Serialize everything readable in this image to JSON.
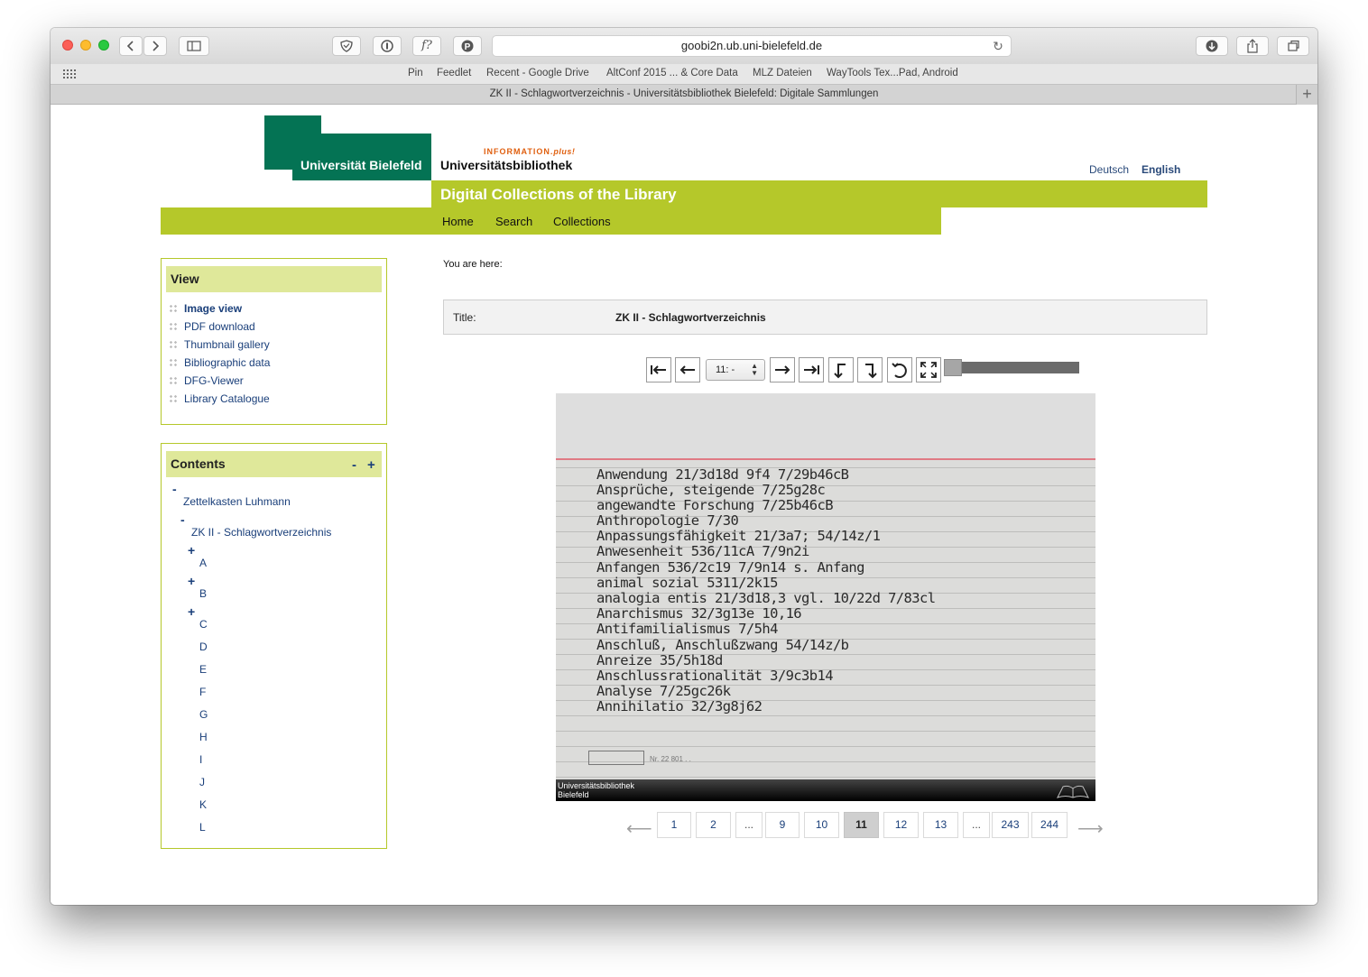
{
  "browser": {
    "url": "goobi2n.ub.uni-bielefeld.de",
    "bookmarks": [
      "Pin",
      "Feedlet",
      "Recent - Google Drive",
      "AltConf 2015 ... & Core Data",
      "MLZ Dateien",
      "WayTools Tex...Pad, Android"
    ],
    "tab_title": "ZK II - Schlagwortverzeichnis - Universitätsbibliothek Bielefeld: Digitale Sammlungen"
  },
  "header": {
    "university": "Universität Bielefeld",
    "info_prefix": "INFORMATION.",
    "info_plus": "plus!",
    "library": "Universitätsbibliothek",
    "lang_de": "Deutsch",
    "lang_en": "English",
    "banner": "Digital Collections of the Library",
    "nav": [
      "Home",
      "Search",
      "Collections"
    ]
  },
  "view_box": {
    "title": "View",
    "items": [
      "Image view",
      "PDF download",
      "Thumbnail gallery",
      "Bibliographic data",
      "DFG-Viewer",
      "Library Catalogue"
    ]
  },
  "contents_box": {
    "title": "Contents",
    "collapse_all": "-",
    "expand_all": "+",
    "root": "Zettelkasten Luhmann",
    "child": "ZK II - Schlagwortverzeichnis",
    "letters": [
      "A",
      "B",
      "C",
      "D",
      "E",
      "F",
      "G",
      "H",
      "I",
      "J",
      "K",
      "L"
    ],
    "expandable_letters": [
      "A",
      "B",
      "C"
    ]
  },
  "main": {
    "breadcrumb": "You are here:",
    "title_label": "Title:",
    "title_value": "ZK II - Schlagwortverzeichnis",
    "page_select": "11: -",
    "zoom_level": 0
  },
  "scan": {
    "lines": [
      "Anwendung 21/3d18d 9f4 7/29b46cB",
      "Ansprüche, steigende 7/25g28c",
      "angewandte Forschung 7/25b46cB",
      "Anthropologie 7/30",
      "Anpassungsfähigkeit 21/3a7; 54/14z/1",
      "Anwesenheit 536/11cA 7/9n2i",
      "Anfangen 536/2c19 7/9n14 s. Anfang",
      "animal sozial 5311/2k15",
      "analogia entis 21/3d18,3 vgl. 10/22d 7/83cl",
      "Anarchismus 32/3g13e 10,16",
      "Antifamilialismus 7/5h4",
      "Anschluß, Anschlußzwang 54/14z/b",
      "Anreize 35/5h18d",
      "Anschlussrationalität 3/9c3b14",
      "Analyse 7/25gc26k",
      "Annihilatio 32/3g8j62"
    ],
    "card_number": "Nr. 22 801 . .",
    "footer_line1": "Universitätsbibliothek",
    "footer_line2": "Bielefeld"
  },
  "pagination": {
    "pages": [
      "1",
      "2",
      "...",
      "9",
      "10",
      "11",
      "12",
      "13",
      "...",
      "243",
      "244"
    ],
    "current": "11"
  }
}
